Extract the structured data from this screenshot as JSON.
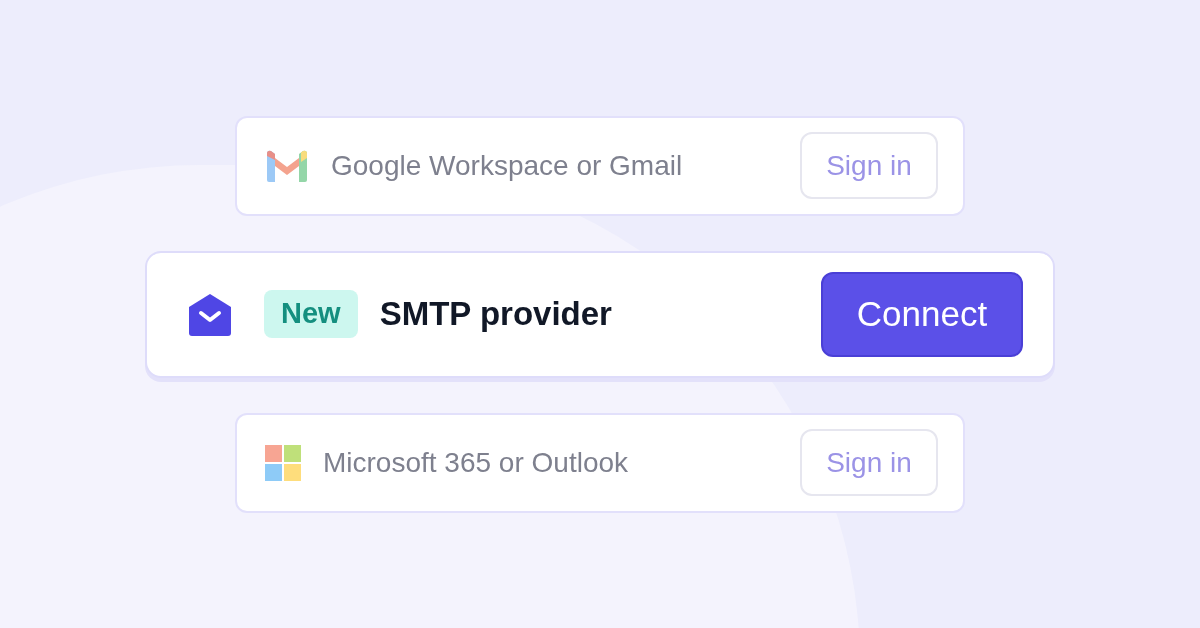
{
  "providers": [
    {
      "kind": "gmail",
      "featured": false,
      "name": "Google Workspace or Gmail",
      "button": "Sign in"
    },
    {
      "kind": "smtp",
      "featured": true,
      "badge": "New",
      "name": "SMTP provider",
      "button": "Connect"
    },
    {
      "kind": "microsoft",
      "featured": false,
      "name": "Microsoft 365 or Outlook",
      "button": "Sign in"
    }
  ]
}
